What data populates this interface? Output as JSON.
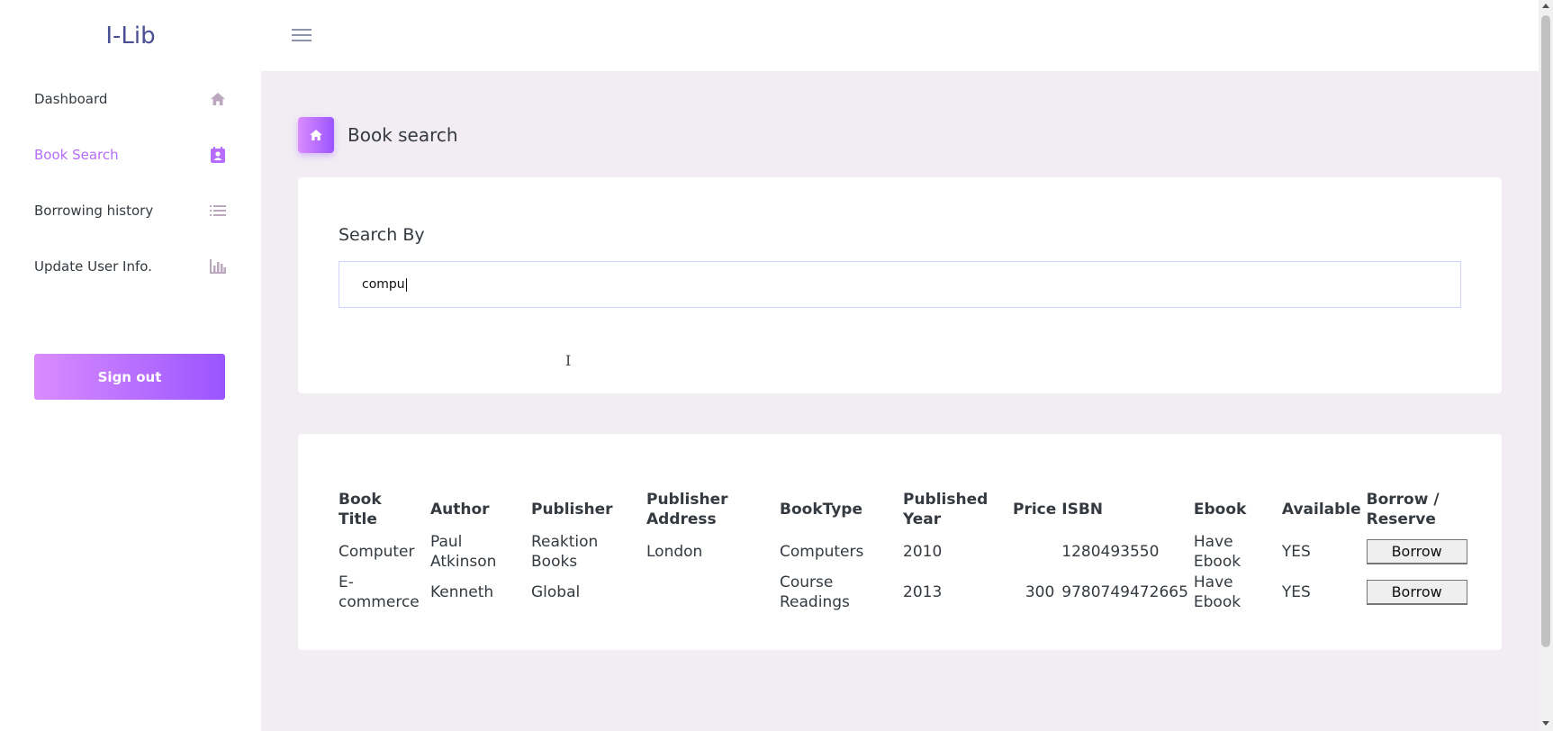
{
  "app": {
    "brand": "I-Lib"
  },
  "sidebar": {
    "items": [
      {
        "label": "Dashboard",
        "icon": "home-icon"
      },
      {
        "label": "Book Search",
        "icon": "contact-card-icon",
        "active": true
      },
      {
        "label": "Borrowing history",
        "icon": "list-icon"
      },
      {
        "label": "Update User Info.",
        "icon": "bar-chart-icon"
      }
    ],
    "signout_label": "Sign out"
  },
  "page": {
    "title": "Book search",
    "icon": "home-icon"
  },
  "search": {
    "label": "Search By",
    "value": "compu"
  },
  "results": {
    "headers": [
      "Book Title",
      "Author",
      "Publisher",
      "Publisher Address",
      "BookType",
      "Published Year",
      "Price",
      "ISBN",
      "Ebook",
      "Available",
      "Borrow / Reserve"
    ],
    "rows": [
      {
        "title": "Computer",
        "author": "Paul Atkinson",
        "publisher": "Reaktion Books",
        "address": "London",
        "type": "Computers",
        "year": "2010",
        "price": "",
        "isbn": "1280493550",
        "ebook": "Have Ebook",
        "available": "YES",
        "action": "Borrow"
      },
      {
        "title": "E-commerce",
        "author": "Kenneth",
        "publisher": "Global",
        "address": "",
        "type": "Course Readings",
        "year": "2013",
        "price": "300",
        "isbn": "9780749472665",
        "ebook": "Have Ebook",
        "available": "YES",
        "action": "Borrow"
      }
    ]
  },
  "colors": {
    "accent": "#b66dff",
    "gradient_start": "#da8cff",
    "gradient_end": "#9a55ff",
    "content_bg": "#f2edf3",
    "brand": "#4a4e93"
  }
}
